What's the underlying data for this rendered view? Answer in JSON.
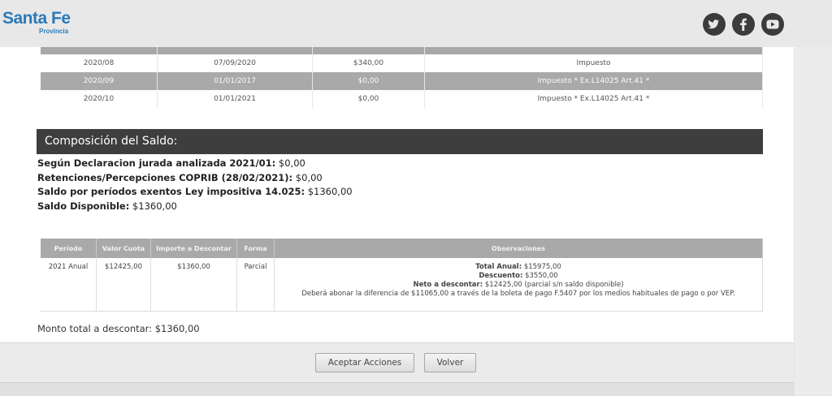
{
  "header": {
    "logo_main": "Santa Fe",
    "logo_sub": "Provincia",
    "social": [
      "twitter-icon",
      "facebook-icon",
      "youtube-icon"
    ]
  },
  "periods_table": {
    "rows": [
      {
        "periodo": "2020/08",
        "fecha": "07/09/2020",
        "importe": "$340,00",
        "concepto": "Impuesto"
      },
      {
        "periodo": "2020/09",
        "fecha": "01/01/2017",
        "importe": "$0,00",
        "concepto": "Impuesto * Ex.L14025 Art.41 *"
      },
      {
        "periodo": "2020/10",
        "fecha": "01/01/2021",
        "importe": "$0,00",
        "concepto": "Impuesto * Ex.L14025 Art.41 *"
      }
    ]
  },
  "composicion": {
    "title": "Composición del Saldo:",
    "lines": [
      {
        "label": "Según Declaracion jurada analizada 2021/01:",
        "value": " $0,00"
      },
      {
        "label": "Retenciones/Percepciones COPRIB (28/02/2021):",
        "value": " $0,00"
      },
      {
        "label": "Saldo por períodos exentos Ley impositiva 14.025:",
        "value": " $1360,00"
      },
      {
        "label": "Saldo Disponible:",
        "value": " $1360,00"
      }
    ]
  },
  "descuento_table": {
    "headers": [
      "Período",
      "Valor Cuota",
      "Importe a Descontar",
      "Forma",
      "Observaciones"
    ],
    "row": {
      "periodo": "2021 Anual",
      "valor_cuota": "$12425,00",
      "importe": "$1360,00",
      "forma": "Parcial",
      "obs_total_label": "Total Anual:",
      "obs_total_value": " $15975,00",
      "obs_desc_label": "Descuento:",
      "obs_desc_value": " $3550,00",
      "obs_neto_label": "Neto a descontar:",
      "obs_neto_value": " $12425,00 (parcial s/n saldo disponible)",
      "obs_note": "Deberá abonar la diferencia de $11065,00 a través de la boleta de pago F.5407 por los medios habituales de pago o por VEP."
    }
  },
  "monto_total": "Monto total a descontar: $1360,00",
  "buttons": {
    "accept": "Aceptar Acciones",
    "back": "Volver"
  }
}
